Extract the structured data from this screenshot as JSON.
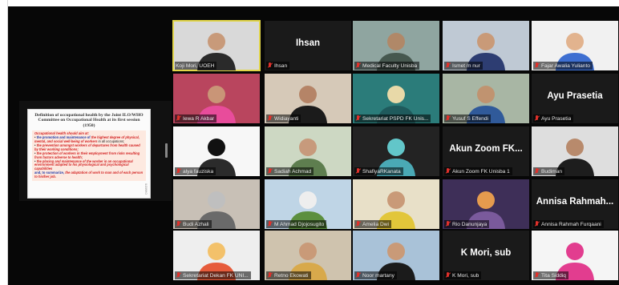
{
  "shared_slide": {
    "title": "Definition of occupational health by the Joint ILO/WHO Committee on Occupational Health at its first session (1950)",
    "intro": "Occupational health should aim at:",
    "bullets": [
      [
        "the promotion and maintenance of ",
        "the highest degree of physical, mental, and social well-being of workers",
        " in all occupations;"
      ],
      [
        "",
        "the prevention amongst workers of departures from health caused by their working conditions;",
        ""
      ],
      [
        "",
        "the protection of workers in their employment from risks resulting from factors adverse to health;",
        ""
      ],
      [
        "",
        "the placing and maintenance of the worker in an occupational environment adapted to his physiological and psychological capabilities",
        ""
      ]
    ],
    "closing": [
      "and, to summarize, ",
      "the adaptation of work to man and of each person to his/her job."
    ],
    "side_label": "ILO/WHO"
  },
  "participants": [
    {
      "name": "Koji Mori, UOEH",
      "display": "",
      "muted": false,
      "active": true,
      "bg": "#d9d9d9",
      "skin": "#c89a7a",
      "shirt": "#2a2a2a"
    },
    {
      "name": "Ihsan",
      "display": "Ihsan",
      "muted": true,
      "bg": "#1a1a1a"
    },
    {
      "name": "Medical Faculty Unisba",
      "display": "",
      "muted": true,
      "bg": "#8fa5a0",
      "skin": "#b08868",
      "shirt": "#46584f"
    },
    {
      "name": "Ismet m nur",
      "display": "",
      "muted": true,
      "bg": "#bfc9d4",
      "skin": "#c99a78",
      "shirt": "#2d3d72"
    },
    {
      "name": "Fajar Awalia Yulianto",
      "display": "",
      "muted": true,
      "bg": "#f1f1f1",
      "skin": "#e2b38e",
      "shirt": "#3e6fd1"
    },
    {
      "name": "Iewa R Akbar",
      "display": "",
      "muted": true,
      "bg": "#b9455e",
      "skin": "#c99577",
      "shirt": "#e84c9b"
    },
    {
      "name": "Widiayanti",
      "display": "",
      "muted": true,
      "bg": "#d6c9b8",
      "skin": "#b58467",
      "shirt": "#1b1b1b"
    },
    {
      "name": "Sekretariat PSPD FK Unis...",
      "display": "",
      "muted": true,
      "bg": "#2b7c7a",
      "skin": "#e8d9a8",
      "shirt": "#1f5a5c"
    },
    {
      "name": "Yusuf S Effendi",
      "display": "",
      "muted": true,
      "bg": "#a8b6a4",
      "skin": "#c09370",
      "shirt": "#305a9a"
    },
    {
      "name": "Ayu Prasetia",
      "display": "Ayu Prasetia",
      "muted": true,
      "bg": "#1a1a1a"
    },
    {
      "name": "alya fauziska",
      "display": "",
      "muted": true,
      "bg": "#f7f7f7",
      "skin": "#111111",
      "shirt": "#2b2b2b"
    },
    {
      "name": "Sadiah Achmad",
      "display": "",
      "muted": true,
      "bg": "#cdd8c3",
      "skin": "#c79a7c",
      "shirt": "#5e7e4f"
    },
    {
      "name": "ShafiyaRKanata",
      "display": "",
      "muted": true,
      "bg": "#232323",
      "skin": "#62c6c9",
      "shirt": "#4aa9b5"
    },
    {
      "name": "Akun Zoom FK Unisba 1",
      "display": "Akun Zoom FK...",
      "muted": true,
      "bg": "#1a1a1a"
    },
    {
      "name": "Budiman",
      "display": "",
      "muted": true,
      "bg": "#dedede",
      "skin": "#b88a6c",
      "shirt": "#1d1d1d"
    },
    {
      "name": "Budi Azhali",
      "display": "",
      "muted": true,
      "bg": "#c8c0b6",
      "skin": "#bfbfbf",
      "shirt": "#6a6a6a"
    },
    {
      "name": "M Ahmad Djojosugito",
      "display": "",
      "muted": true,
      "bg": "#bfd5e6",
      "skin": "#eeeeee",
      "shirt": "#5c8f3f"
    },
    {
      "name": "Amelia Dwi",
      "display": "",
      "muted": true,
      "bg": "#e8e0c8",
      "skin": "#c99a78",
      "shirt": "#e2c63a"
    },
    {
      "name": "Rio Danunjaya",
      "display": "",
      "muted": true,
      "bg": "#3e2f58",
      "skin": "#e59b4e",
      "shirt": "#7a5a9c"
    },
    {
      "name": "Annisa Rahmah Furqaani",
      "display": "Annisa Rahmah...",
      "muted": true,
      "bg": "#1a1a1a"
    },
    {
      "name": "Sekretariat Dekan FK UNI...",
      "display": "",
      "muted": true,
      "bg": "#eeeeee",
      "skin": "#f3c16a",
      "shirt": "#e65b3b"
    },
    {
      "name": "Retno Ekowati",
      "display": "",
      "muted": true,
      "bg": "#cfc3ae",
      "skin": "#c99a78",
      "shirt": "#d8a94b"
    },
    {
      "name": "Noor martany",
      "display": "",
      "muted": true,
      "bg": "#a9c2d8",
      "skin": "#c99a78",
      "shirt": "#1b1b1b"
    },
    {
      "name": "K Mori, sub",
      "display": "K Mori, sub",
      "muted": true,
      "bg": "#1a1a1a"
    },
    {
      "name": "Tita Siddiq",
      "display": "",
      "muted": true,
      "bg": "#f5f5f5",
      "skin": "#e23d8f",
      "shirt": "#e23d8f"
    }
  ]
}
